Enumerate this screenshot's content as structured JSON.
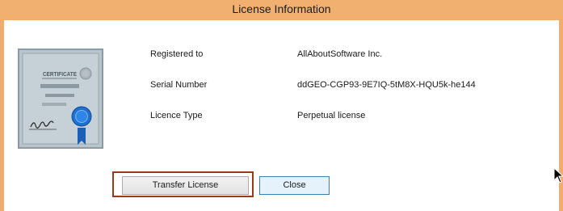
{
  "window": {
    "title": "License Information"
  },
  "certificate": {
    "badge_text": "CERTIFICATE",
    "icon": "certificate-icon"
  },
  "fields": [
    {
      "label": "Registered to",
      "value": "AllAboutSoftware Inc."
    },
    {
      "label": "Serial Number",
      "value": "ddGEO-CGP93-9E7IQ-5tM8X-HQU5k-he144"
    },
    {
      "label": "Licence Type",
      "value": "Perpetual license"
    }
  ],
  "buttons": {
    "transfer_label": "Transfer License",
    "close_label": "Close"
  },
  "colors": {
    "title_bar": "#f1b06f",
    "focus_ring": "#9a3a17",
    "close_button_border": "#3c7fb1"
  }
}
